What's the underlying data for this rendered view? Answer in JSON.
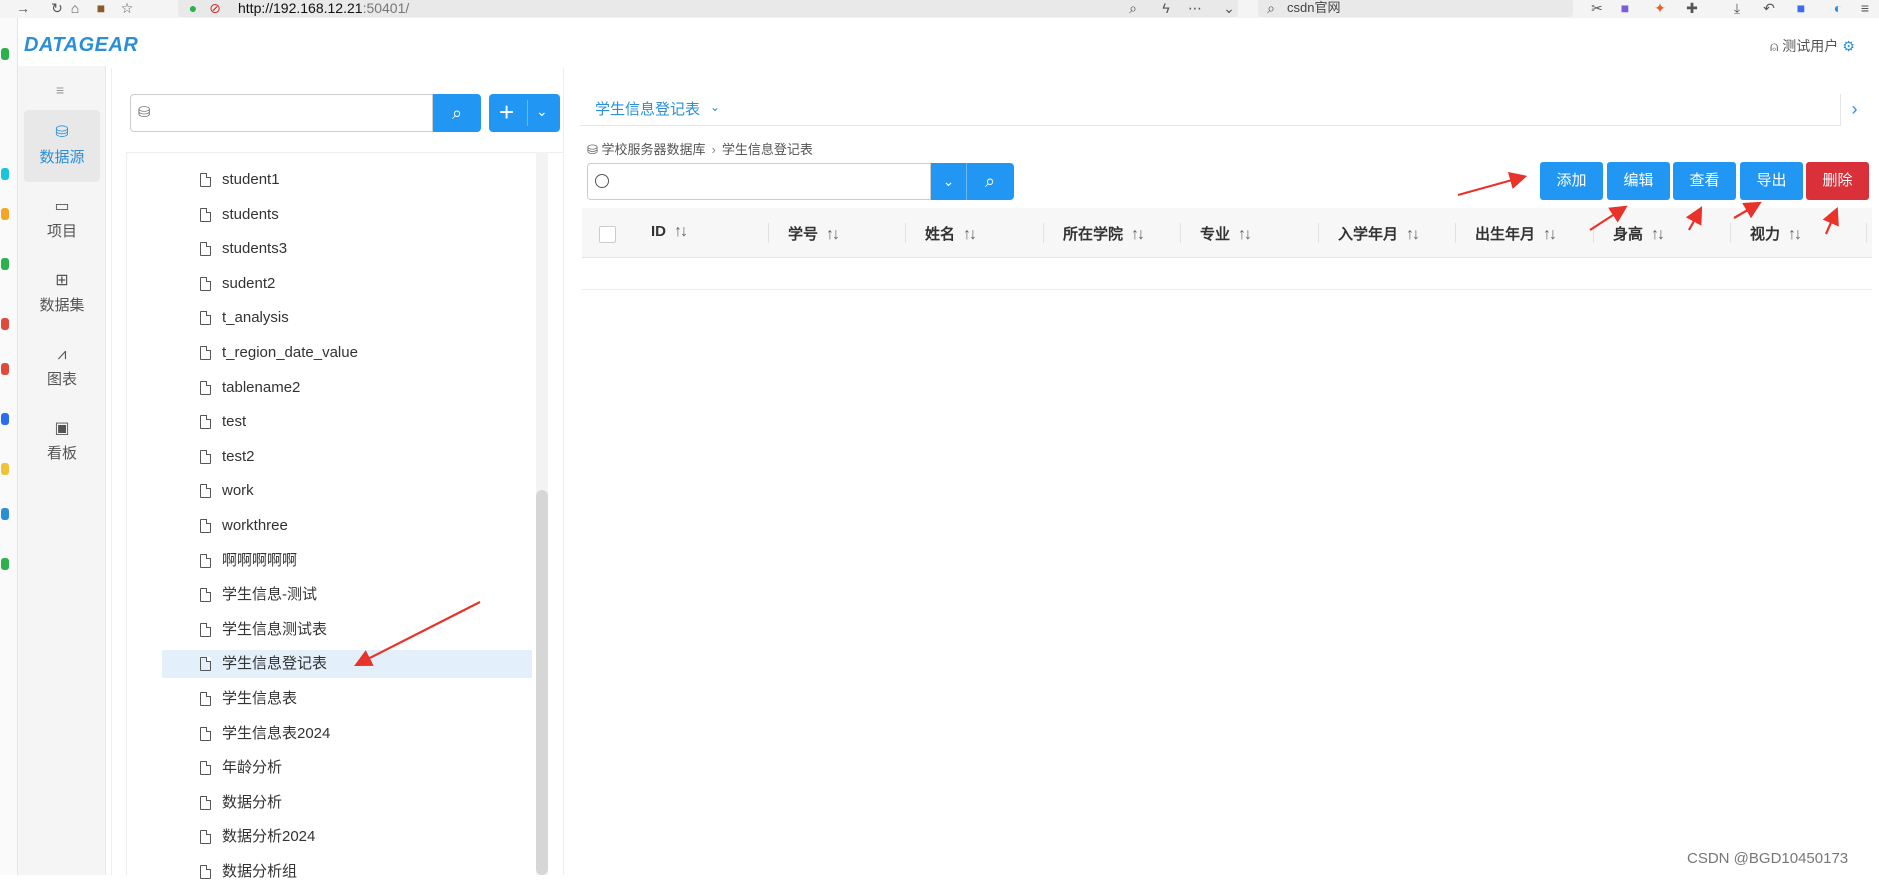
{
  "browser": {
    "url_host": "http://192.168.12.21",
    "url_rest": ":50401/",
    "search_text": "csdn官网"
  },
  "app": {
    "logo": "DATAGEAR",
    "user": "测试用户"
  },
  "nav": {
    "items": [
      {
        "label": "数据源",
        "icon": "database-icon",
        "glyph": "⛁",
        "active": true
      },
      {
        "label": "项目",
        "icon": "folder-icon",
        "glyph": "▭",
        "active": false
      },
      {
        "label": "数据集",
        "icon": "table-icon",
        "glyph": "⊞",
        "active": false
      },
      {
        "label": "图表",
        "icon": "line-chart-icon",
        "glyph": "⩘",
        "active": false
      },
      {
        "label": "看板",
        "icon": "image-icon",
        "glyph": "▣",
        "active": false
      }
    ]
  },
  "tree": {
    "search_placeholder": "",
    "add_label": "+",
    "items": [
      "student1",
      "students",
      "students3",
      "sudent2",
      "t_analysis",
      "t_region_date_value",
      "tablename2",
      "test",
      "test2",
      "work",
      "workthree",
      "啊啊啊啊啊",
      "学生信息-测试",
      "学生信息测试表",
      "学生信息登记表",
      "学生信息表",
      "学生信息表2024",
      "年龄分析",
      "数据分析",
      "数据分析2024",
      "数据分析组"
    ],
    "selected_index": 14
  },
  "main": {
    "tab_label": "学生信息登记表",
    "breadcrumb": [
      "学校服务器数据库",
      "学生信息登记表"
    ],
    "query_value": "",
    "actions": [
      "添加",
      "编辑",
      "查看",
      "导出",
      "删除"
    ],
    "columns": [
      "ID",
      "学号",
      "姓名",
      "所在学院",
      "专业",
      "入学年月",
      "出生年月",
      "身高",
      "视力"
    ]
  },
  "watermark": "CSDN @BGD10450173",
  "colors": {
    "primary": "#2196f3",
    "danger": "#d9303a",
    "logo": "#2a8fd6",
    "annotation_arrow": "#e8322a"
  }
}
